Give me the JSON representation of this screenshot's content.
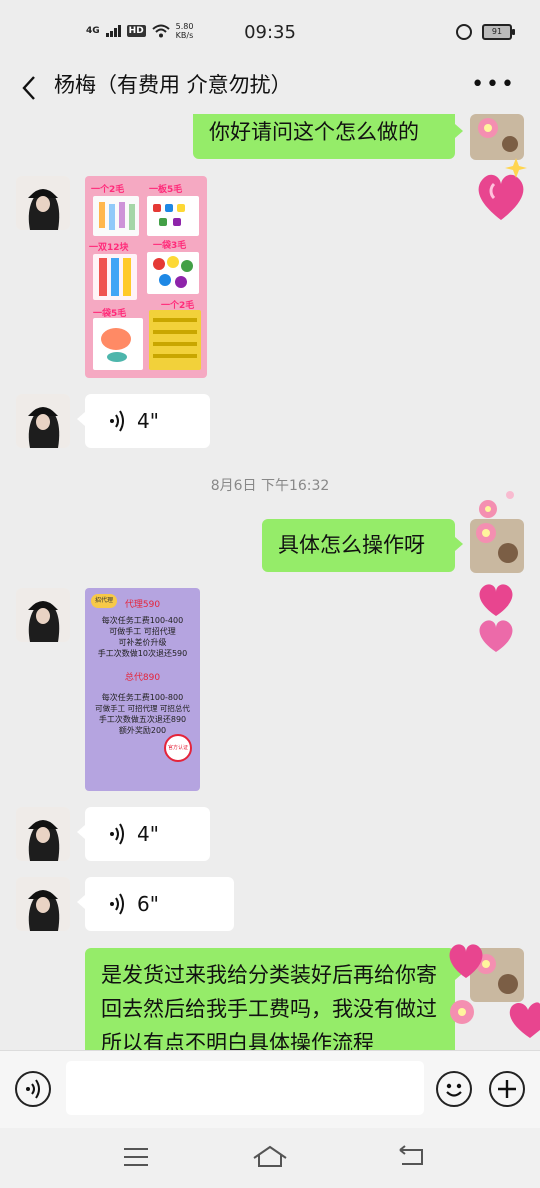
{
  "status_bar": {
    "network": "4G",
    "hd": "HD",
    "speed_value": "5.80",
    "speed_unit": "KB/s",
    "time": "09:35",
    "battery": "91"
  },
  "header": {
    "title": "杨梅（有费用 介意勿扰）",
    "more": "•••"
  },
  "messages": {
    "m1_text": "你好请问这个怎么做的",
    "craft_image": {
      "labels": [
        "一个2毛",
        "一板5毛",
        "一双12块",
        "一袋3毛",
        "一袋5毛",
        "一个2毛"
      ]
    },
    "voice1_duration": "4\"",
    "timestamp": "8月6日 下午16:32",
    "m2_text": "具体怎么操作呀",
    "price_image": {
      "badge": "招代理",
      "agent_title": "代理590",
      "agent_lines": [
        "每次任务工费100-400",
        "可做手工 可招代理",
        "可补差价升级",
        "手工次数做10次退还590"
      ],
      "general_title": "总代890",
      "general_lines": [
        "每次任务工费100-800",
        "可做手工 可招代理 可招总代",
        "手工次数做五次退还890",
        "额外奖励200"
      ],
      "stamp": "官方认证"
    },
    "voice2_duration": "4\"",
    "voice3_duration": "6\"",
    "m3_text": "是发货过来我给分类装好后再给你寄回去然后给我手工费吗，我没有做过所以有点不明白具体操作流程"
  },
  "colors": {
    "background": "#ededed",
    "bubble_out": "#95ec69",
    "bubble_in": "#ffffff"
  },
  "icons": [
    "back-icon",
    "more-icon",
    "voice-wave-icon",
    "voice-toggle-icon",
    "emoji-icon",
    "plus-icon",
    "menu-icon",
    "home-icon",
    "return-icon",
    "alarm-icon",
    "battery-icon",
    "wifi-icon",
    "signal-icon"
  ]
}
